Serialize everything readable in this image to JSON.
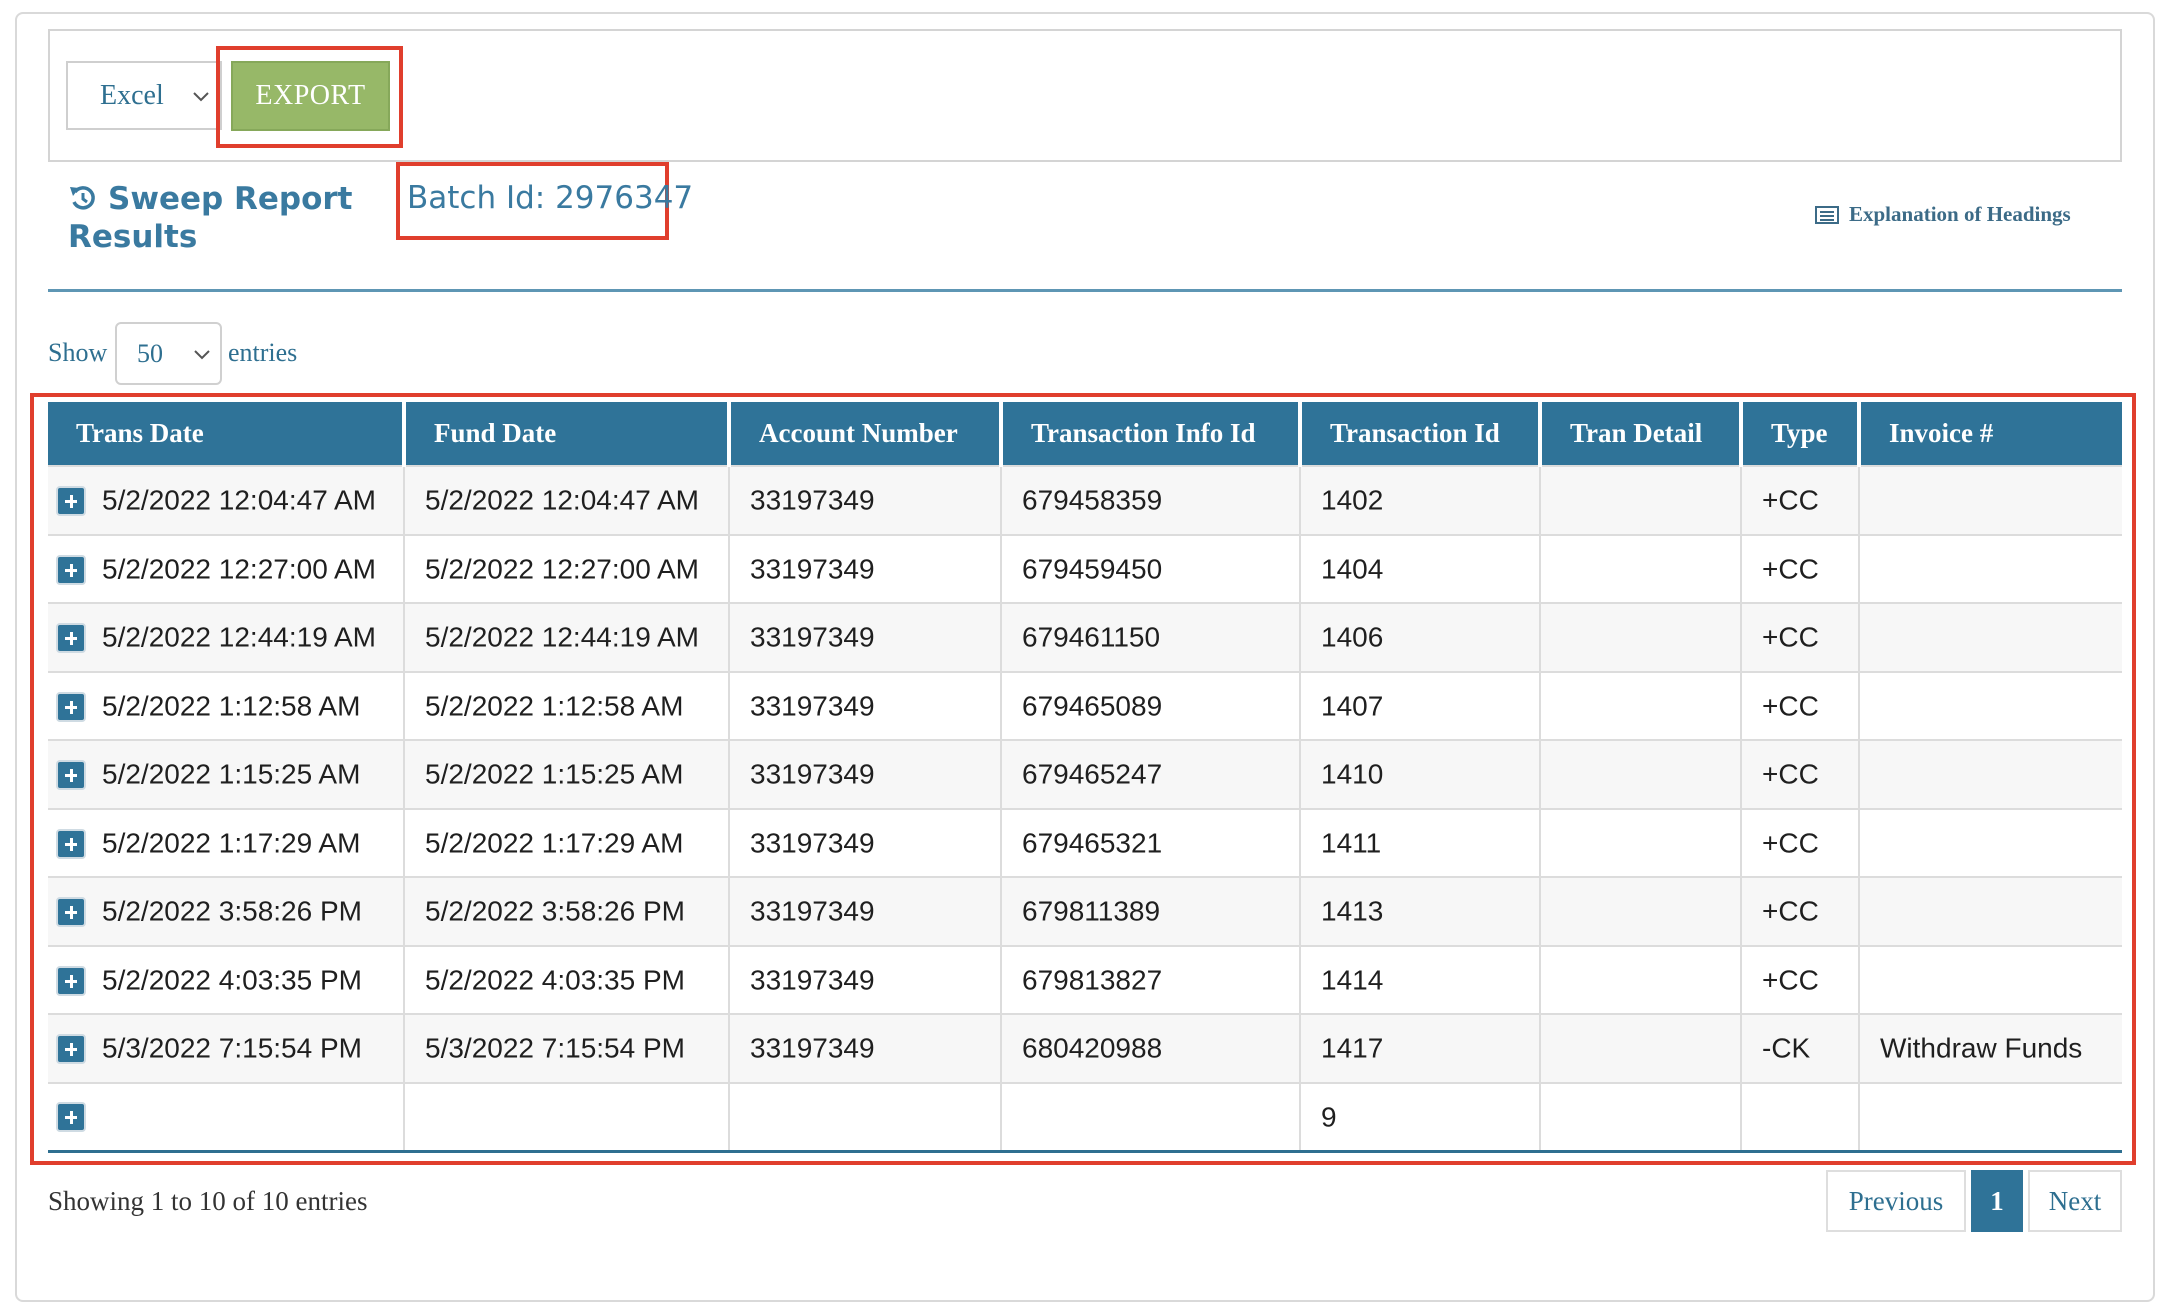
{
  "toolbar": {
    "format_selected": "Excel",
    "export_label": "EXPORT"
  },
  "header": {
    "title": "Sweep Report Results",
    "batch_id": "Batch Id: 2976347",
    "explanation_link": "Explanation of Headings"
  },
  "length_control": {
    "show_label": "Show",
    "selected": "50",
    "entries_label": "entries"
  },
  "table": {
    "columns": [
      "Trans Date",
      "Fund Date",
      "Account Number",
      "Transaction Info Id",
      "Transaction Id",
      "Tran Detail",
      "Type",
      "Invoice #"
    ],
    "rows": [
      [
        "5/2/2022 12:04:47 AM",
        "5/2/2022 12:04:47 AM",
        "33197349",
        "679458359",
        "1402",
        "",
        "+CC",
        ""
      ],
      [
        "5/2/2022 12:27:00 AM",
        "5/2/2022 12:27:00 AM",
        "33197349",
        "679459450",
        "1404",
        "",
        "+CC",
        ""
      ],
      [
        "5/2/2022 12:44:19 AM",
        "5/2/2022 12:44:19 AM",
        "33197349",
        "679461150",
        "1406",
        "",
        "+CC",
        ""
      ],
      [
        "5/2/2022 1:12:58 AM",
        "5/2/2022 1:12:58 AM",
        "33197349",
        "679465089",
        "1407",
        "",
        "+CC",
        ""
      ],
      [
        "5/2/2022 1:15:25 AM",
        "5/2/2022 1:15:25 AM",
        "33197349",
        "679465247",
        "1410",
        "",
        "+CC",
        ""
      ],
      [
        "5/2/2022 1:17:29 AM",
        "5/2/2022 1:17:29 AM",
        "33197349",
        "679465321",
        "1411",
        "",
        "+CC",
        ""
      ],
      [
        "5/2/2022 3:58:26 PM",
        "5/2/2022 3:58:26 PM",
        "33197349",
        "679811389",
        "1413",
        "",
        "+CC",
        ""
      ],
      [
        "5/2/2022 4:03:35 PM",
        "5/2/2022 4:03:35 PM",
        "33197349",
        "679813827",
        "1414",
        "",
        "+CC",
        ""
      ],
      [
        "5/3/2022 7:15:54 PM",
        "5/3/2022 7:15:54 PM",
        "33197349",
        "680420988",
        "1417",
        "",
        "-CK",
        "Withdraw Funds"
      ],
      [
        "",
        "",
        "",
        "",
        "9",
        "",
        "",
        ""
      ]
    ]
  },
  "footer": {
    "showing": "Showing 1 to 10 of 10 entries",
    "previous": "Previous",
    "current_page": "1",
    "next": "Next"
  },
  "colors": {
    "header_blue": "#2f7398",
    "link_blue": "#3a7aa0",
    "export_green": "#97b868",
    "highlight_red": "#e03e2d"
  },
  "icons": {
    "title_icon": "refresh-icon",
    "explanation_icon": "document-list-icon",
    "row_expand_icon": "plus-square-icon"
  }
}
